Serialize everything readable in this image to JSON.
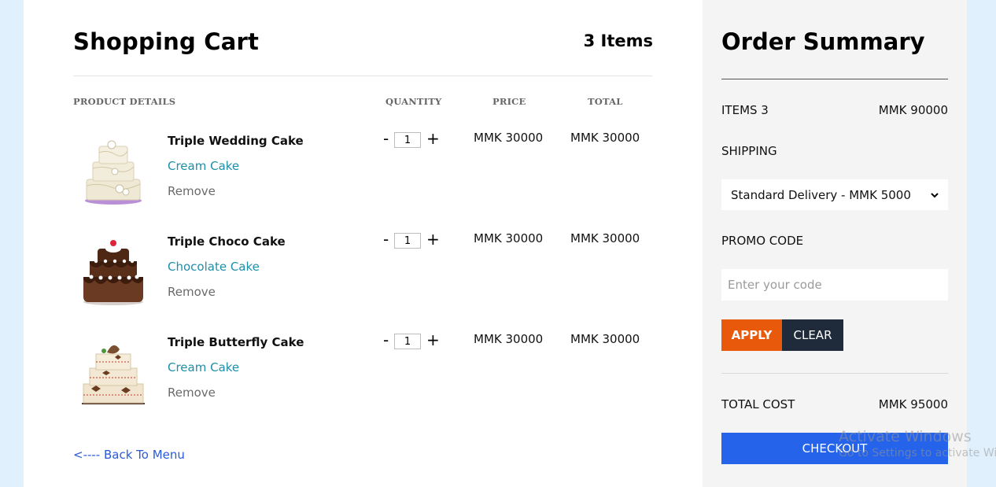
{
  "cart": {
    "title": "Shopping Cart",
    "item_count": "3 Items",
    "columns": {
      "product": "PRODUCT DETAILS",
      "quantity": "QUANTITY",
      "price": "PRICE",
      "total": "TOTAL"
    },
    "items": [
      {
        "name": "Triple Wedding Cake",
        "category": "Cream Cake",
        "remove": "Remove",
        "minus": "-",
        "qty": "1",
        "plus": "+",
        "price": "MMK 30000",
        "total": "MMK 30000",
        "image": "wedding-cake-image"
      },
      {
        "name": "Triple Choco Cake",
        "category": "Chocolate Cake",
        "remove": "Remove",
        "minus": "-",
        "qty": "1",
        "plus": "+",
        "price": "MMK 30000",
        "total": "MMK 30000",
        "image": "chocolate-cake-image"
      },
      {
        "name": "Triple Butterfly Cake",
        "category": "Cream Cake",
        "remove": "Remove",
        "minus": "-",
        "qty": "1",
        "plus": "+",
        "price": "MMK 30000",
        "total": "MMK 30000",
        "image": "butterfly-cake-image"
      }
    ],
    "back_link": "<---- Back To Menu"
  },
  "summary": {
    "title": "Order Summary",
    "items_label": "ITEMS 3",
    "items_value": "MMK 90000",
    "shipping_label": "SHIPPING",
    "shipping_selected": "Standard Delivery - MMK 5000",
    "promo_label": "PROMO CODE",
    "promo_placeholder": "Enter your code",
    "apply_label": "APPLY",
    "clear_label": "CLEAR",
    "total_label": "TOTAL COST",
    "total_value": "MMK 95000",
    "checkout_label": "CHECKOUT"
  },
  "watermark": {
    "title": "Activate Windows",
    "subtitle": "Go to Settings to activate Windows."
  },
  "colors": {
    "background": "#e0f1fd",
    "category_link": "#1f8ea6",
    "back_link": "#2a5ad9",
    "apply": "#e8590c",
    "clear": "#1f2a3a",
    "checkout": "#2563eb"
  }
}
